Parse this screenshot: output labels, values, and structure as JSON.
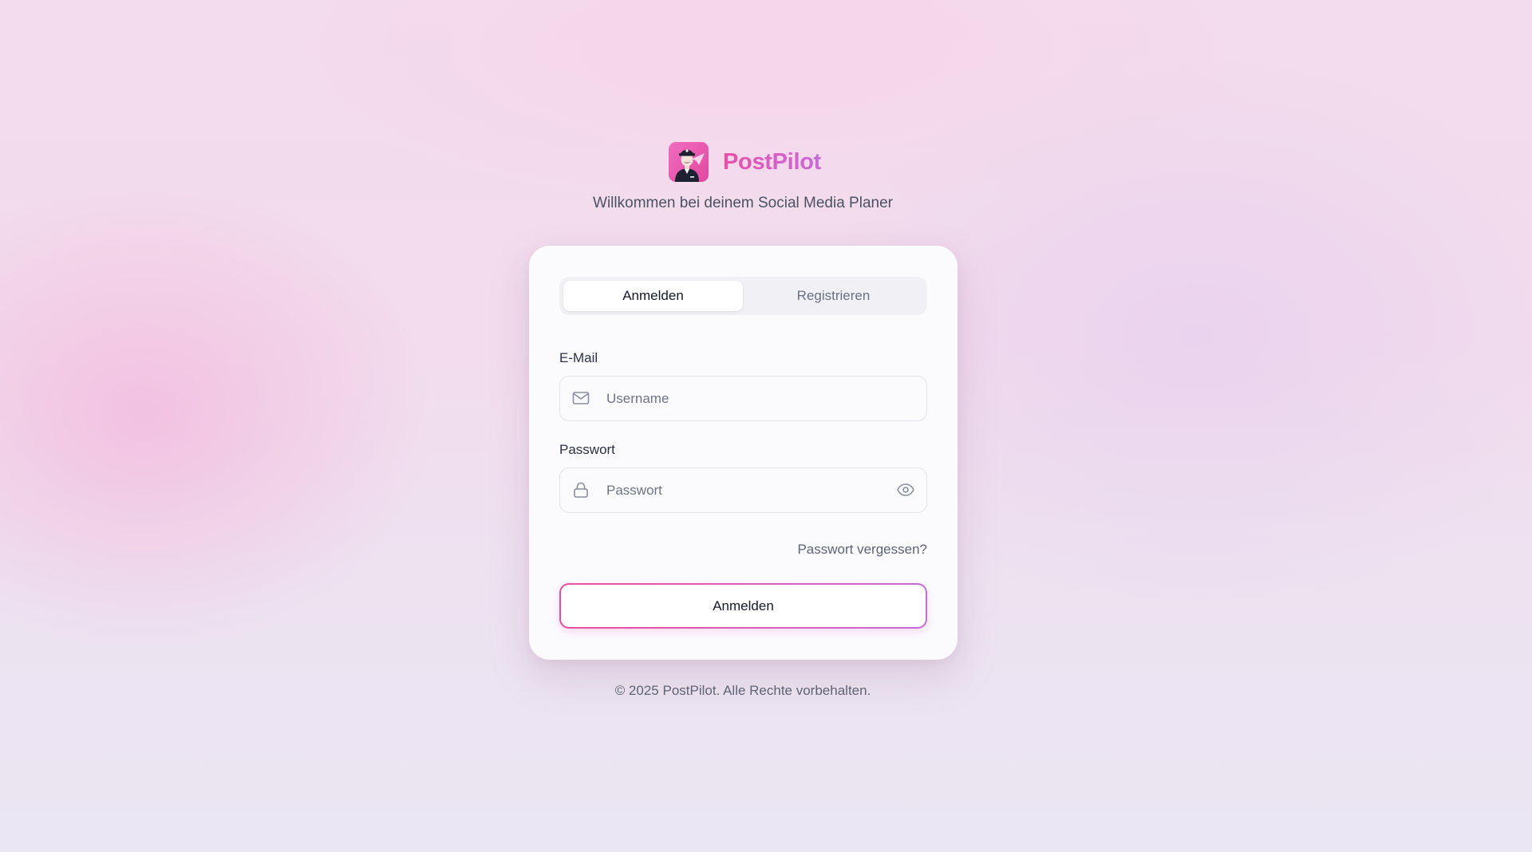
{
  "brand": {
    "name": "PostPilot",
    "subtitle": "Willkommen bei deinem Social Media Planer",
    "logo_icon": "pilot-paper-plane-icon"
  },
  "tabs": [
    {
      "label": "Anmelden",
      "active": true
    },
    {
      "label": "Registrieren",
      "active": false
    }
  ],
  "form": {
    "email_label": "E-Mail",
    "email_placeholder": "Username",
    "email_icon": "mail-icon",
    "password_label": "Passwort",
    "password_placeholder": "Passwort",
    "password_icon": "lock-icon",
    "password_toggle_icon": "eye-icon",
    "forgot_label": "Passwort vergessen?",
    "submit_label": "Anmelden"
  },
  "footer": {
    "copyright": "© 2025 PostPilot. Alle Rechte vorbehalten."
  },
  "colors": {
    "accent_pink": "#ec4fa8",
    "accent_purple": "#c86ad9",
    "text_dark": "#141a2a",
    "text_muted": "#6a7083"
  }
}
